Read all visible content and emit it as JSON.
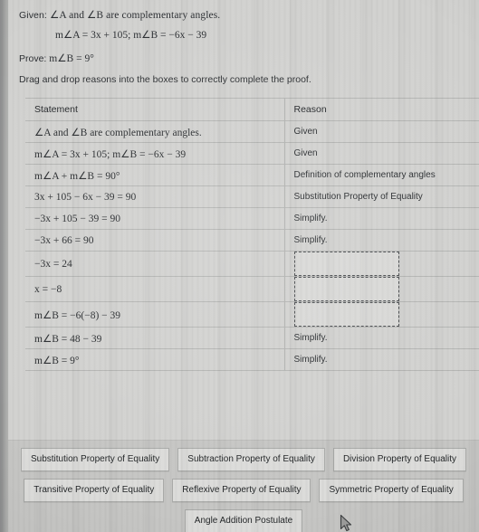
{
  "problem": {
    "given_label": "Given:",
    "given_text": "∠A and ∠B are complementary angles.",
    "given_equations": "m∠A = 3x + 105; m∠B = −6x − 39",
    "prove_label": "Prove:",
    "prove_text": "m∠B = 9°",
    "instruction": "Drag and drop reasons into the boxes to correctly complete the proof."
  },
  "table": {
    "headers": {
      "statement": "Statement",
      "reason": "Reason"
    },
    "rows": [
      {
        "statement": "∠A and ∠B are complementary angles.",
        "reason": "Given",
        "empty": false
      },
      {
        "statement": "m∠A = 3x + 105; m∠B = −6x − 39",
        "reason": "Given",
        "empty": false
      },
      {
        "statement": "m∠A + m∠B = 90°",
        "reason": "Definition of complementary angles",
        "empty": false
      },
      {
        "statement": "3x + 105 − 6x − 39 = 90",
        "reason": "Substitution Property of Equality",
        "empty": false
      },
      {
        "statement": "−3x + 105 − 39 = 90",
        "reason": "Simplify.",
        "empty": false
      },
      {
        "statement": "−3x + 66 = 90",
        "reason": "Simplify.",
        "empty": false
      },
      {
        "statement": "−3x = 24",
        "reason": "",
        "empty": true
      },
      {
        "statement": "x = −8",
        "reason": "",
        "empty": true
      },
      {
        "statement": "m∠B = −6(−8) − 39",
        "reason": "",
        "empty": true
      },
      {
        "statement": "m∠B = 48 − 39",
        "reason": "Simplify.",
        "empty": false
      },
      {
        "statement": "m∠B = 9°",
        "reason": "Simplify.",
        "empty": false
      }
    ]
  },
  "tray": {
    "row1": [
      "Substitution Property of Equality",
      "Subtraction Property of Equality",
      "Division Property of Equality"
    ],
    "row2": [
      "Transitive Property of Equality",
      "Reflexive Property of Equality",
      "Symmetric Property of Equality"
    ],
    "row3": [
      "Angle Addition Postulate"
    ]
  },
  "colors": {
    "page_background": "#d2d2d0",
    "tray_background": "#c6c6c4",
    "chip_background": "#dcdcda",
    "text": "#2b2e31",
    "rule": "#b5b6b4",
    "dropzone_border": "#4b4e51"
  }
}
